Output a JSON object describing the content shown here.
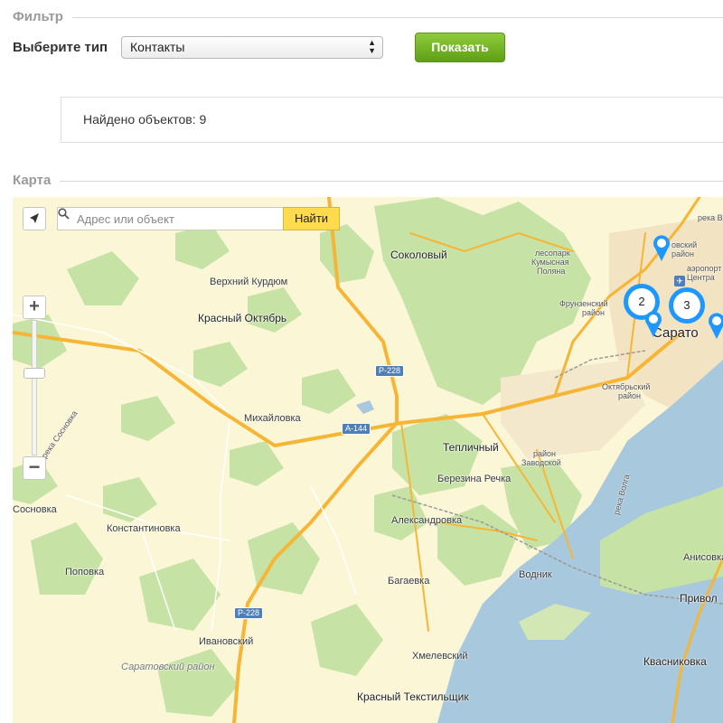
{
  "filter": {
    "legend": "Фильтр",
    "type_label": "Выберите тип",
    "type_selected": "Контакты",
    "show_button": "Показать",
    "results_text": "Найдено объектов: 9"
  },
  "map": {
    "legend": "Карта",
    "search_placeholder": "Адрес или объект",
    "find_button": "Найти",
    "zoom_in": "+",
    "zoom_out": "−",
    "clusters": [
      {
        "count": "2"
      },
      {
        "count": "3"
      }
    ],
    "labels": {
      "sokolovy": "Соколовый",
      "verkhniy_kurdyum": "Верхний Курдюм",
      "krasny_oktyabr": "Красный Октябрь",
      "mikhaylovka": "Михайловка",
      "teplichny": "Тепличный",
      "berezina_rechka": "Березина Речка",
      "aleksandrovka": "Александровка",
      "konstantinovka": "Константиновка",
      "popovka": "Поповка",
      "sosnovka": "Сосновка",
      "reka_sosnovka": "река Сосновка",
      "bagaevka": "Багаевка",
      "vodnik": "Водник",
      "ivanovsky": "Ивановский",
      "saratovsky_rayon": "Саратовский район",
      "khmelevsky": "Хмелевский",
      "krasny_tekstilshchik": "Красный Текстильщик",
      "kvasnikovka": "Квасниковка",
      "anisovka": "Анисовка",
      "privolzhsky": "Привол",
      "lesopark": "лесопарк",
      "kumysnaya": "Кумысная",
      "polyana": "Поляна",
      "frunzensky": "Фрунзенский",
      "rayon": "район",
      "oktyabrsky": "Октябрьский",
      "rayon2": "район",
      "rayon_zavodskoy_1": "район",
      "rayon_zavodskoy_2": "Заводской",
      "reka_volga": "река Волга",
      "reka_top": "река В",
      "volzhsky_rayon": "овский",
      "volzhsky_rayon2": "район",
      "aeroport": "аэропорт",
      "tsentralny": "Центра",
      "saratov": "Сарато"
    },
    "road_shields": {
      "r228_top": "Р-228",
      "a144": "А-144",
      "r228_bottom": "Р-228"
    },
    "colors": {
      "land": "#faf6d6",
      "forest": "#c6e3a5",
      "water": "#a7c8dd",
      "road": "#f7b536",
      "cluster": "#1e98ff",
      "city": "#f2e3c2"
    }
  }
}
